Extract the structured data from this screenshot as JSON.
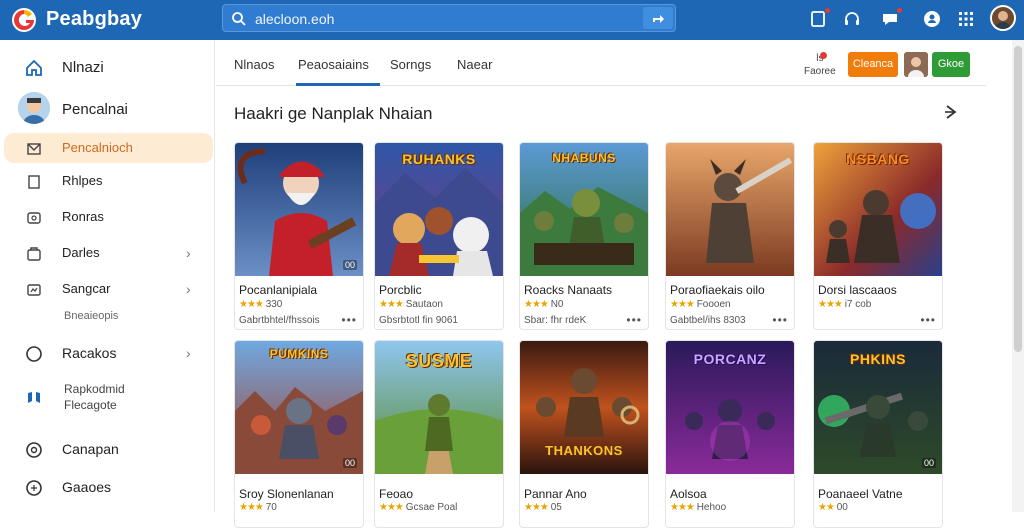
{
  "app": {
    "title": "Peabgbay"
  },
  "search": {
    "value": "alecloon.eoh"
  },
  "sidebar": {
    "items": [
      {
        "label": "Nlnazi"
      },
      {
        "label": "Pencalnai"
      },
      {
        "label": "Pencalnioch"
      },
      {
        "label": "Rhlpes"
      },
      {
        "label": "Ronras"
      },
      {
        "label": "Darles"
      },
      {
        "label": "Sangcar"
      },
      {
        "label": "Bneaieopis"
      },
      {
        "label": "Racakos"
      },
      {
        "label": "Rapkodmid"
      },
      {
        "label": "Flecagote"
      },
      {
        "label": "Canapan"
      },
      {
        "label": "Gaaoes"
      }
    ]
  },
  "tabs": [
    {
      "label": "Nlnaos"
    },
    {
      "label": "Peaosaiains"
    },
    {
      "label": "Sorngs"
    },
    {
      "label": "Naear"
    }
  ],
  "toolbar": {
    "small_line1": "ls",
    "small_line2": "Faoree",
    "orange_button": "Cleanca",
    "green_button": "Gkoe"
  },
  "section": {
    "title": "Haakri ge Nanplak Nhaian"
  },
  "cards": [
    {
      "thumb_word": "",
      "title": "Pocanlanipiala",
      "rating": "330",
      "meta": "Gabrtbhtel/fhssois",
      "badge": "00"
    },
    {
      "thumb_word": "RUHANKS",
      "title": "Porcblic",
      "rating": "Sautaon",
      "meta": "Gbsrbtotl fin 9061",
      "badge": ""
    },
    {
      "thumb_word": "NHABUNS",
      "title": "Roacks Nanaats",
      "rating": "N0",
      "meta": "Sbar: fhr rdeK",
      "badge": ""
    },
    {
      "thumb_word": "",
      "title": "Poraofiaekais oilo",
      "rating": "Foooen",
      "meta": "Gabtbel/ihs 8303",
      "badge": ""
    },
    {
      "thumb_word": "NSBANG",
      "title": "Dorsi lascaaos",
      "rating": "i7 cob",
      "meta": "",
      "badge": ""
    },
    {
      "thumb_word": "PUMKINS",
      "title": "Sroy Slonenlanan",
      "rating": "70",
      "meta": "",
      "badge": "00"
    },
    {
      "thumb_word": "SUSME",
      "title": "Feoao",
      "rating": "Gcsae Poal",
      "meta": "",
      "badge": ""
    },
    {
      "thumb_word": "THANKONS",
      "title": "Pannar Ano",
      "rating": "05",
      "meta": "",
      "badge": ""
    },
    {
      "thumb_word": "PORCANZ",
      "title": "Aolsoa",
      "rating": "Hehoo",
      "meta": "",
      "badge": ""
    },
    {
      "thumb_word": "PHKINS",
      "title": "Poanaeel Vatne",
      "rating": "00",
      "meta": "",
      "badge": "00"
    }
  ],
  "colors": {
    "topbar": "#1d67b5",
    "accent_orange": "#f07c0c",
    "accent_green": "#2e9b37",
    "active_bg": "#fdebd3"
  },
  "icons": [
    "logo-icon",
    "search-icon",
    "clipboard-icon",
    "headset-icon",
    "chat-icon",
    "user-circle-icon",
    "grid-icon",
    "home-icon",
    "mail-icon",
    "bookmark-icon",
    "image-icon",
    "bag-icon",
    "chart-icon",
    "circle-icon",
    "compass-icon",
    "gamepad-icon"
  ]
}
